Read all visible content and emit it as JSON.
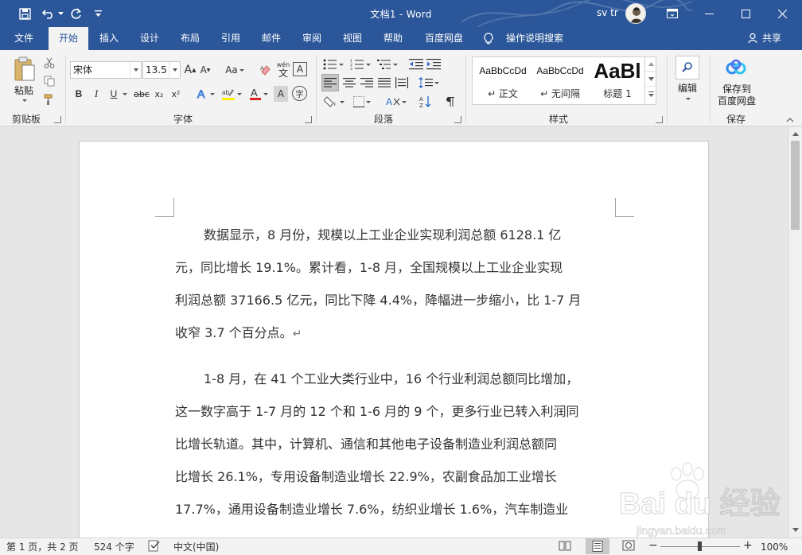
{
  "titlebar": {
    "title": "文档1  -  Word",
    "user": "sv tr",
    "save_icon": "save-icon",
    "undo_icon": "undo-icon",
    "redo_icon": "redo-icon",
    "customize_icon": "customize-quick-access-icon"
  },
  "tabs": [
    {
      "label": "文件"
    },
    {
      "label": "开始"
    },
    {
      "label": "插入"
    },
    {
      "label": "设计"
    },
    {
      "label": "布局"
    },
    {
      "label": "引用"
    },
    {
      "label": "邮件"
    },
    {
      "label": "审阅"
    },
    {
      "label": "视图"
    },
    {
      "label": "帮助"
    },
    {
      "label": "百度网盘"
    }
  ],
  "active_tab": "开始",
  "tell_me": "操作说明搜索",
  "share": "共享",
  "ribbon": {
    "clipboard": {
      "label": "剪贴板",
      "paste": "粘贴"
    },
    "font": {
      "label": "字体",
      "font_name": "宋体",
      "font_size": "13.5",
      "bold": "B",
      "italic": "I",
      "underline": "U",
      "strike": "abc",
      "subscript": "x₂",
      "superscript": "x²",
      "change_case": "Aa",
      "phonetic": "wén",
      "grow": "A",
      "shrink": "A",
      "border_char": "A",
      "enclose_char": "字"
    },
    "paragraph": {
      "label": "段落"
    },
    "styles": {
      "label": "样式",
      "items": [
        {
          "preview": "AaBbCcDd",
          "name": "↵ 正文"
        },
        {
          "preview": "AaBbCcDd",
          "name": "↵ 无间隔"
        },
        {
          "preview": "AaBl",
          "name": "标题 1"
        }
      ]
    },
    "editing": {
      "label": "编辑"
    },
    "save": {
      "label": "保存",
      "button_line1": "保存到",
      "button_line2": "百度网盘"
    }
  },
  "document": {
    "paragraphs": [
      {
        "lines": [
          "数据显示，8 月份，规模以上工业企业实现利润总额 6128.1 亿",
          "元，同比增长 19.1%。累计看，1-8 月，全国规模以上工业企业实现",
          "利润总额 37166.5 亿元，同比下降 4.4%，降幅进一步缩小，比 1-7 月",
          "收窄 3.7 个百分点。"
        ]
      },
      {
        "lines": [
          "1-8 月，在 41 个工业大类行业中，16 个行业利润总额同比增加，",
          "这一数字高于 1-7 月的 12 个和 1-6 月的 9 个，更多行业已转入利润同",
          "比增长轨道。其中，计算机、通信和其他电子设备制造业利润总额同",
          "比增长 26.1%，专用设备制造业增长 22.9%，农副食品加工业增长",
          "17.7%，通用设备制造业增长 7.6%，纺织业增长 1.6%，汽车制造业"
        ]
      }
    ],
    "pilcrow": "↵"
  },
  "statusbar": {
    "page": "第 1 页，共 2 页",
    "words": "524 个字",
    "language": "中文(中国)",
    "zoom_out": "−",
    "zoom_in": "+",
    "zoom": "100%",
    "zoom_value": 100
  },
  "watermark": {
    "brand": "Bai du 经验",
    "url": "jingyan.baidu.com"
  },
  "colors": {
    "accent": "#2b579a",
    "ribbon_bg": "#f3f3f3",
    "doc_bg": "#e6e6e6",
    "font_color_red": "#e0201c",
    "highlight_yellow": "#ffee00"
  }
}
